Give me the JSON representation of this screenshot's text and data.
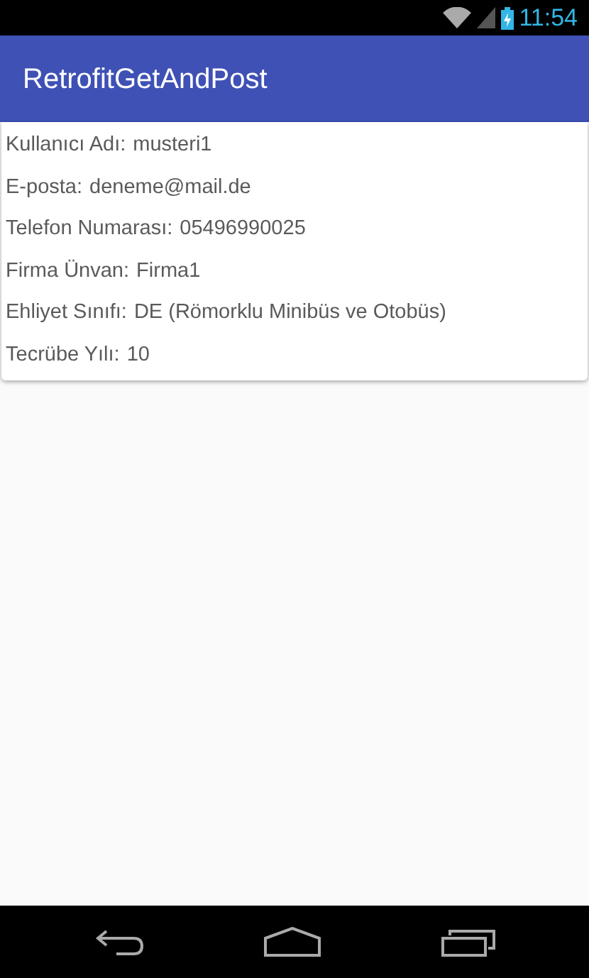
{
  "status_bar": {
    "time": "11:54"
  },
  "app_bar": {
    "title": "RetrofitGetAndPost"
  },
  "fields": [
    {
      "label": "Kullanıcı Adı:",
      "value": "musteri1"
    },
    {
      "label": "E-posta:",
      "value": "deneme@mail.de"
    },
    {
      "label": "Telefon Numarası:",
      "value": "05496990025"
    },
    {
      "label": "Firma Ünvan:",
      "value": "Firma1"
    },
    {
      "label": "Ehliyet Sınıfı:",
      "value": "DE (Römorklu Minibüs ve Otobüs)"
    },
    {
      "label": "Tecrübe Yılı:",
      "value": "10"
    }
  ]
}
